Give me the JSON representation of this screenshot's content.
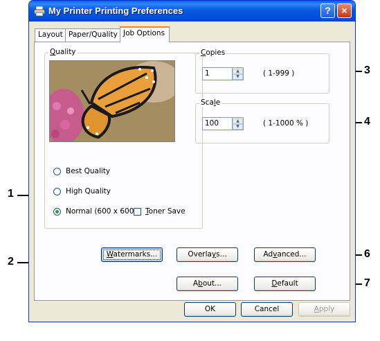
{
  "window": {
    "title": "My Printer Printing Preferences",
    "help": "?",
    "close": "×"
  },
  "tabs": [
    {
      "label": "Layout",
      "active": false
    },
    {
      "label": "Paper/Quality",
      "active": false
    },
    {
      "label": "Job Options",
      "active": true
    }
  ],
  "quality": {
    "label_mnemonic": "Q",
    "label_rest": "uality",
    "options": [
      {
        "label": "Best Quality",
        "selected": false
      },
      {
        "label": "High Quality",
        "selected": false
      },
      {
        "label": "Normal (600 x 600)",
        "selected": true
      }
    ],
    "toner_save": {
      "mnemonic": "T",
      "rest": "oner Save",
      "checked": false
    }
  },
  "copies": {
    "label_mnemonic": "C",
    "label_rest": "opies",
    "value": "1",
    "range": "( 1-999 )"
  },
  "scale": {
    "label_pre": "Sca",
    "label_mnemonic": "l",
    "label_rest": "e",
    "value": "100",
    "range": "( 1-1000 % )"
  },
  "buttons": {
    "watermarks": {
      "mnemonic": "W",
      "rest": "atermarks..."
    },
    "overlays": {
      "pre": "Overla",
      "mnemonic": "y",
      "rest": "s..."
    },
    "advanced": {
      "pre": "Ad",
      "mnemonic": "v",
      "rest": "anced..."
    },
    "about": {
      "pre": "A",
      "mnemonic": "b",
      "rest": "out..."
    },
    "default": {
      "mnemonic": "D",
      "rest": "efault"
    },
    "ok": "OK",
    "cancel": "Cancel",
    "apply": {
      "mnemonic": "A",
      "rest": "pply"
    }
  },
  "callouts": [
    "1",
    "2",
    "3",
    "4",
    "6",
    "7"
  ]
}
